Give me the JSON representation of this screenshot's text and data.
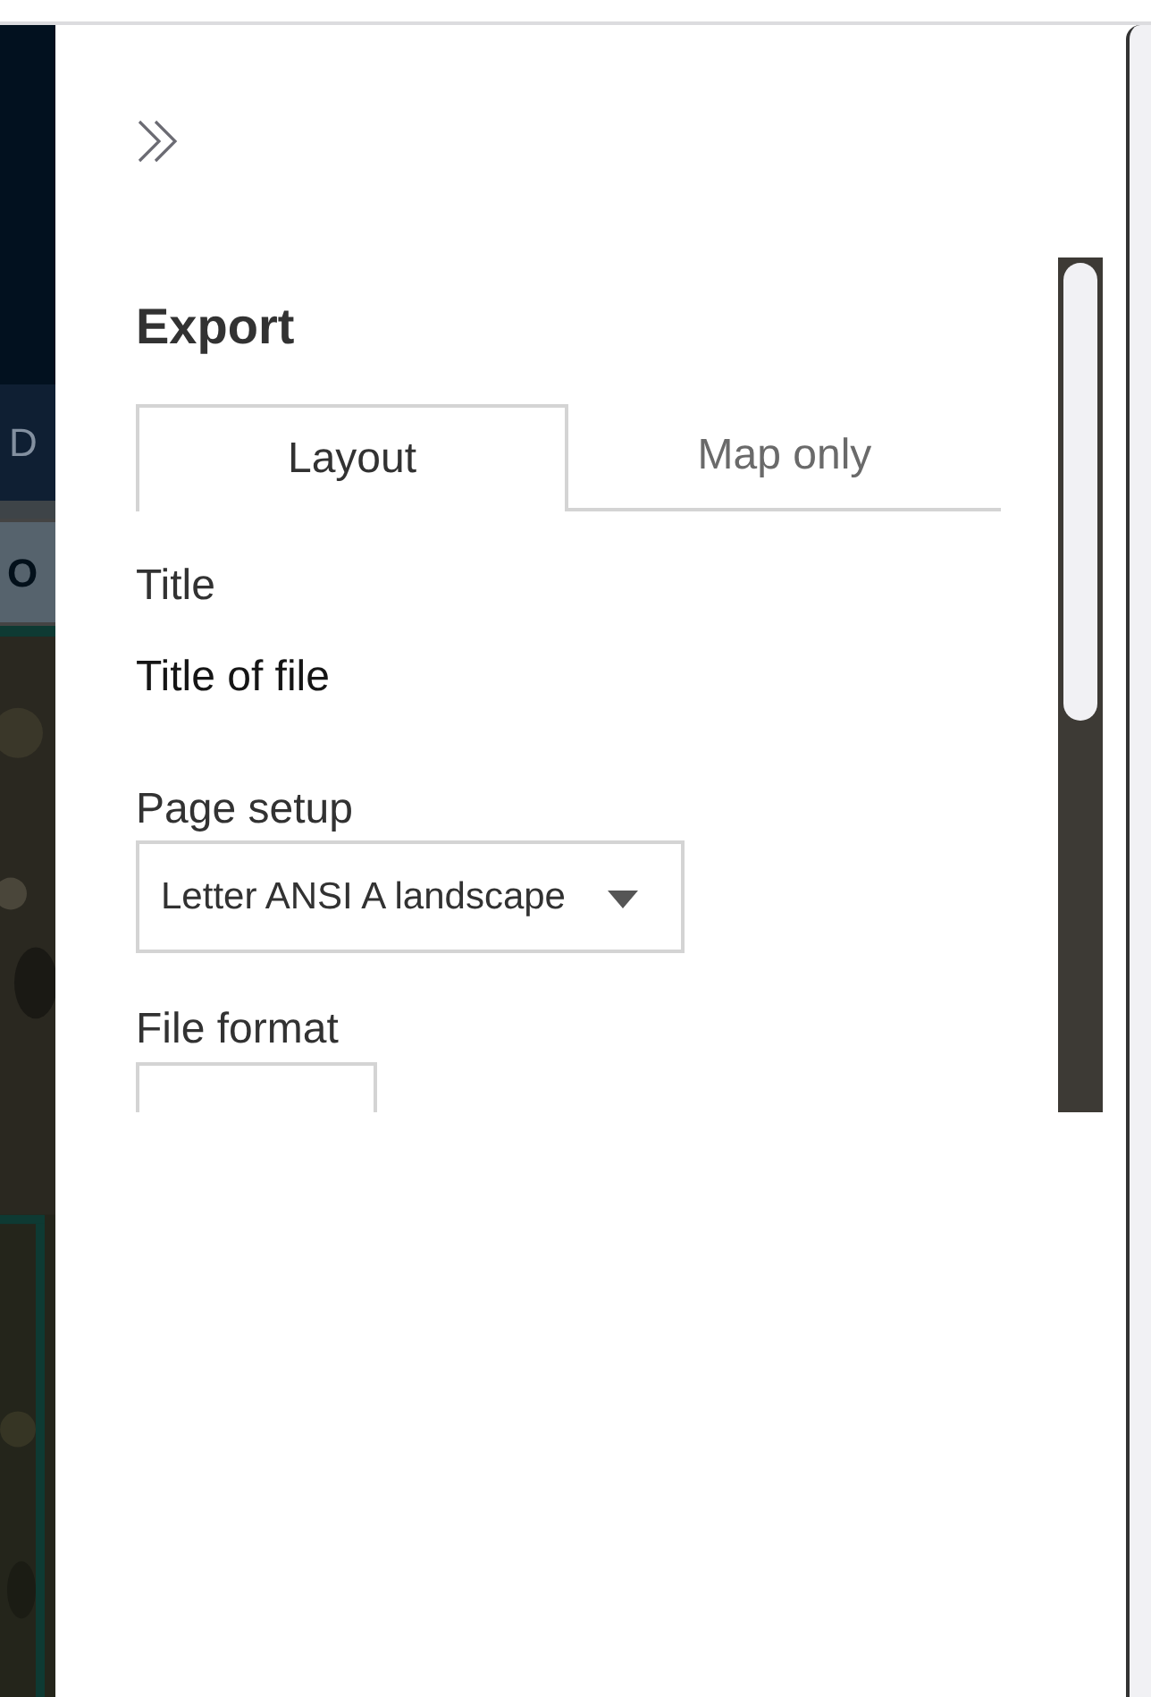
{
  "background": {
    "tab_label": "D",
    "toolbar_label": "O",
    "kind": "picture"
  },
  "panel": {
    "title": "Export",
    "tabs": [
      {
        "label": "Layout",
        "selected": true
      },
      {
        "label": "Map only",
        "selected": false
      }
    ],
    "title_field": {
      "label": "Title",
      "value": "Title of file"
    },
    "page_setup": {
      "label": "Page setup",
      "value": "Letter ANSI A landscape"
    },
    "file_format": {
      "label": "File format"
    }
  }
}
